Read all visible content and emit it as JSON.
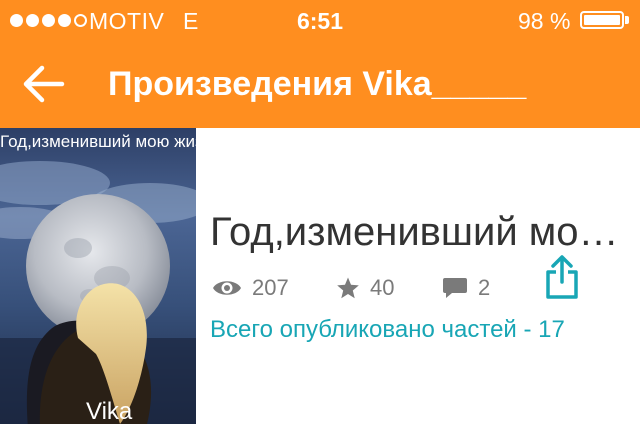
{
  "status_bar": {
    "carrier": "MOTIV",
    "network": "E",
    "time": "6:51",
    "battery_percent": "98 %"
  },
  "navbar": {
    "title": "Произведения Vika_____",
    "back_icon": "arrow-left-icon"
  },
  "book": {
    "cover_title": "Год,изменивший мою жизнь",
    "cover_author": "Vika",
    "title": "Год,изменивший мо…",
    "views": "207",
    "votes": "40",
    "comments": "2",
    "parts_published": "Всего опубликовано частей - 17",
    "share_icon": "share-icon"
  },
  "colors": {
    "header": "#FF8E1F",
    "accent": "#18A6B5",
    "stat_gray": "#7a7a7a"
  }
}
